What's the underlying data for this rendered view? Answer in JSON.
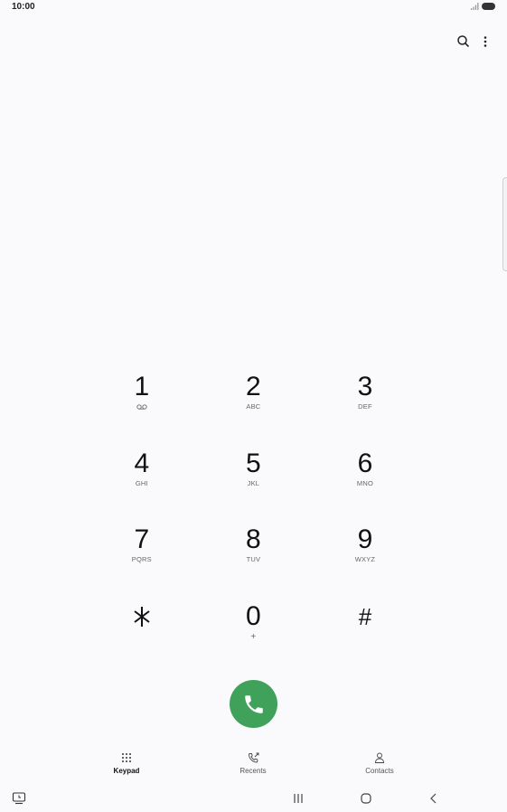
{
  "status_bar": {
    "time": "10:00"
  },
  "keypad": {
    "keys": [
      {
        "digit": "1",
        "letters": ""
      },
      {
        "digit": "2",
        "letters": "ABC"
      },
      {
        "digit": "3",
        "letters": "DEF"
      },
      {
        "digit": "4",
        "letters": "GHI"
      },
      {
        "digit": "5",
        "letters": "JKL"
      },
      {
        "digit": "6",
        "letters": "MNO"
      },
      {
        "digit": "7",
        "letters": "PQRS"
      },
      {
        "digit": "8",
        "letters": "TUV"
      },
      {
        "digit": "9",
        "letters": "WXYZ"
      },
      {
        "digit": "⁎",
        "letters": ""
      },
      {
        "digit": "0",
        "letters": "+"
      },
      {
        "digit": "#",
        "letters": ""
      }
    ]
  },
  "tabs": [
    {
      "label": "Keypad",
      "icon": "keypad-icon",
      "active": true
    },
    {
      "label": "Recents",
      "icon": "recents-icon",
      "active": false
    },
    {
      "label": "Contacts",
      "icon": "contacts-icon",
      "active": false
    }
  ],
  "colors": {
    "call_green": "#3fa15a",
    "background": "#fafafc"
  }
}
